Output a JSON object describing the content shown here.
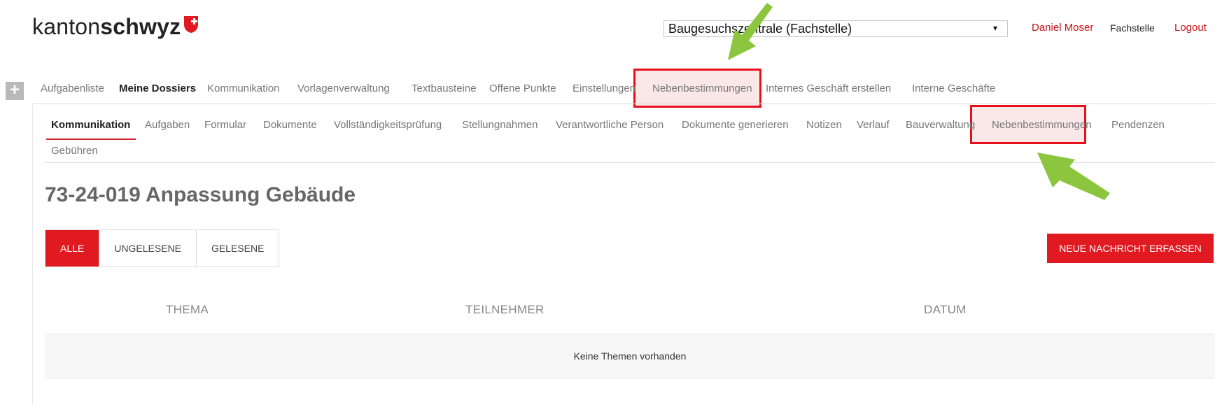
{
  "logo": {
    "prefix": "kanton",
    "bold": "schwyz"
  },
  "header": {
    "role_select_value": "Baugesuchszentrale (Fachstelle)",
    "user_name": "Daniel Moser",
    "user_role": "Fachstelle",
    "logout_label": "Logout"
  },
  "main_nav": [
    {
      "label": "Aufgabenliste"
    },
    {
      "label": "Meine Dossiers"
    },
    {
      "label": "Kommunikation"
    },
    {
      "label": "Vorlagenverwaltung"
    },
    {
      "label": "Textbausteine"
    },
    {
      "label": "Offene Punkte"
    },
    {
      "label": "Einstellungen"
    },
    {
      "label": "Nebenbestimmungen"
    },
    {
      "label": "Internes Geschäft erstellen"
    },
    {
      "label": "Interne Geschäfte"
    }
  ],
  "sub_nav": [
    {
      "label": "Kommunikation"
    },
    {
      "label": "Aufgaben"
    },
    {
      "label": "Formular"
    },
    {
      "label": "Dokumente"
    },
    {
      "label": "Vollständigkeitsprüfung"
    },
    {
      "label": "Stellungnahmen"
    },
    {
      "label": "Verantwortliche Person"
    },
    {
      "label": "Dokumente generieren"
    },
    {
      "label": "Notizen"
    },
    {
      "label": "Verlauf"
    },
    {
      "label": "Bauverwaltung"
    },
    {
      "label": "Nebenbestimmungen"
    },
    {
      "label": "Pendenzen"
    },
    {
      "label": "Gebühren"
    }
  ],
  "page": {
    "title": "73-24-019 Anpassung Gebäude"
  },
  "filters": [
    {
      "label": "ALLE"
    },
    {
      "label": "UNGELESENE"
    },
    {
      "label": "GELESENE"
    }
  ],
  "new_message_label": "NEUE NACHRICHT ERFASSEN",
  "table": {
    "columns": [
      "THEMA",
      "TEILNEHMER",
      "DATUM"
    ],
    "empty_text": "Keine Themen vorhanden"
  },
  "colors": {
    "brand_red": "#e11920",
    "link_red": "#c4141c",
    "highlight_border": "#e8101a",
    "arrow_green": "#8cc63f"
  },
  "icons": {
    "add": "plus-icon",
    "logo": "schwyz-shield-icon",
    "dropdown": "caret-down-icon"
  }
}
